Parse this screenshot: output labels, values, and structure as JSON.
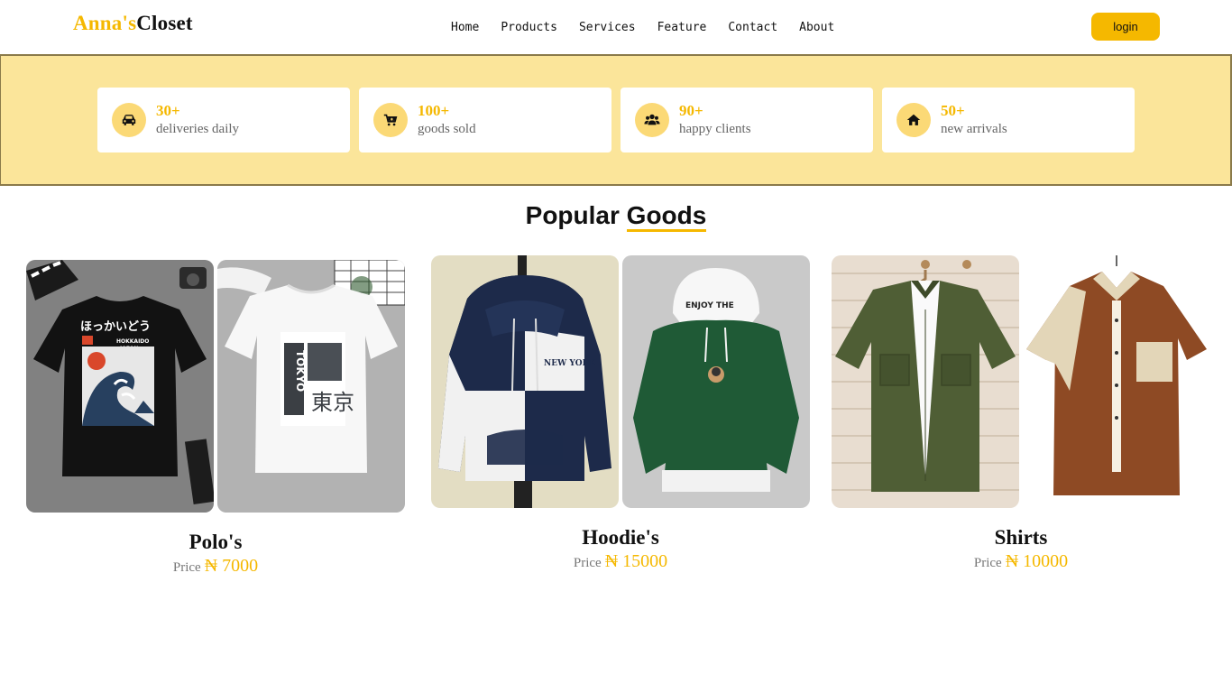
{
  "brand": {
    "first": "Anna's",
    "second": "Closet",
    "accent_color": "#f5b800"
  },
  "nav": {
    "items": [
      {
        "label": "Home"
      },
      {
        "label": "Products"
      },
      {
        "label": "Services"
      },
      {
        "label": "Feature"
      },
      {
        "label": "Contact"
      },
      {
        "label": "About"
      }
    ]
  },
  "header": {
    "login_label": "login"
  },
  "stats": [
    {
      "icon": "car-icon",
      "value": "30+",
      "label": "deliveries daily"
    },
    {
      "icon": "cart-icon",
      "value": "100+",
      "label": "goods sold"
    },
    {
      "icon": "users-icon",
      "value": "90+",
      "label": "happy clients"
    },
    {
      "icon": "home-icon",
      "value": "50+",
      "label": "new arrivals"
    }
  ],
  "section": {
    "title_plain": "Popular",
    "title_underlined": "Goods"
  },
  "products": [
    {
      "name": "Polo's",
      "price_label": "Price",
      "price": "₦ 7000",
      "images": [
        "black-graphic-tshirt",
        "white-tokyo-tshirt"
      ]
    },
    {
      "name": "Hoodie's",
      "price_label": "Price",
      "price": "₦ 15000",
      "images": [
        "navy-white-hoodie",
        "green-hoodie"
      ]
    },
    {
      "name": "Shirts",
      "price_label": "Price",
      "price": "₦ 10000",
      "images": [
        "olive-shirt",
        "brown-shirt"
      ]
    }
  ],
  "colors": {
    "accent": "#f5b800",
    "band": "#fbe59a",
    "icon_circle": "#fbd976"
  }
}
